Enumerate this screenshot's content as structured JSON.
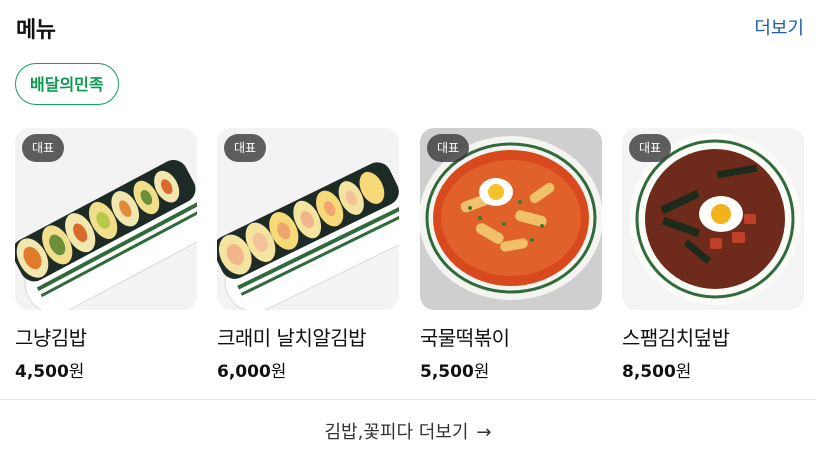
{
  "header": {
    "title": "메뉴",
    "more_label": "더보기"
  },
  "chip": {
    "label": "배달의민족"
  },
  "menu_items": [
    {
      "badge": "대표",
      "name": "그냥김밥",
      "price": "4,500",
      "currency": "원",
      "image": "plain-gimbap-photo"
    },
    {
      "badge": "대표",
      "name": "크래미 날치알김밥",
      "price": "6,000",
      "currency": "원",
      "image": "crab-roe-gimbap-photo"
    },
    {
      "badge": "대표",
      "name": "국물떡볶이",
      "price": "5,500",
      "currency": "원",
      "image": "soup-tteokbokki-photo"
    },
    {
      "badge": "대표",
      "name": "스팸김치덮밥",
      "price": "8,500",
      "currency": "원",
      "image": "spam-kimchi-rice-bowl-photo"
    }
  ],
  "footer": {
    "more_label": "김밥,꽃피다 더보기",
    "arrow_icon": "arrow-right-icon"
  },
  "colors": {
    "accent_green": "#0b9a4e",
    "link_blue": "#1a5fa8",
    "badge_bg": "#3c3c3c"
  }
}
